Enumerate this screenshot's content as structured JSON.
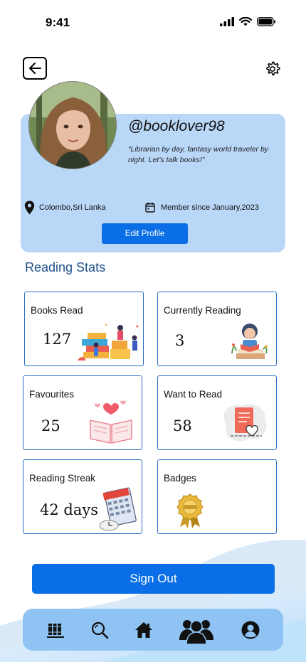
{
  "status_bar": {
    "time": "9:41",
    "icons": [
      "signal-icon",
      "wifi-icon",
      "battery-icon"
    ]
  },
  "header": {
    "back_icon": "arrow-left-icon",
    "settings_icon": "gear-icon"
  },
  "profile": {
    "username": "@booklover98",
    "bio": "“Librarian by day, fantasy world traveler by night. Let’s talk books!”",
    "location": "Colombo,Sri Lanka",
    "member_since": "Member since January,2023",
    "edit_button": "Edit Profile"
  },
  "reading_stats": {
    "title": "Reading Stats",
    "cards": [
      {
        "title": "Books Read",
        "value": "127",
        "icon": "books-stack-illustration"
      },
      {
        "title": "Currently Reading",
        "value": "3",
        "icon": "reading-child-illustration"
      },
      {
        "title": "Favourites",
        "value": "25",
        "icon": "open-book-hearts-illustration"
      },
      {
        "title": "Want to Read",
        "value": "58",
        "icon": "wishlist-document-illustration"
      },
      {
        "title": "Reading Streak",
        "value": "42 days",
        "icon": "calendar-clock-illustration"
      },
      {
        "title": "Badges",
        "value": "",
        "icon": "award-medal-illustration"
      }
    ]
  },
  "sign_out": "Sign Out",
  "bottom_nav": [
    "library-icon",
    "search-icon",
    "home-icon",
    "community-icon",
    "profile-icon"
  ],
  "colors": {
    "accent": "#0a6fe6",
    "card_bg": "#b9d7f7",
    "nav_bg": "#8ec3f3",
    "title": "#1e4e88",
    "card_border": "#2b6cc4"
  }
}
